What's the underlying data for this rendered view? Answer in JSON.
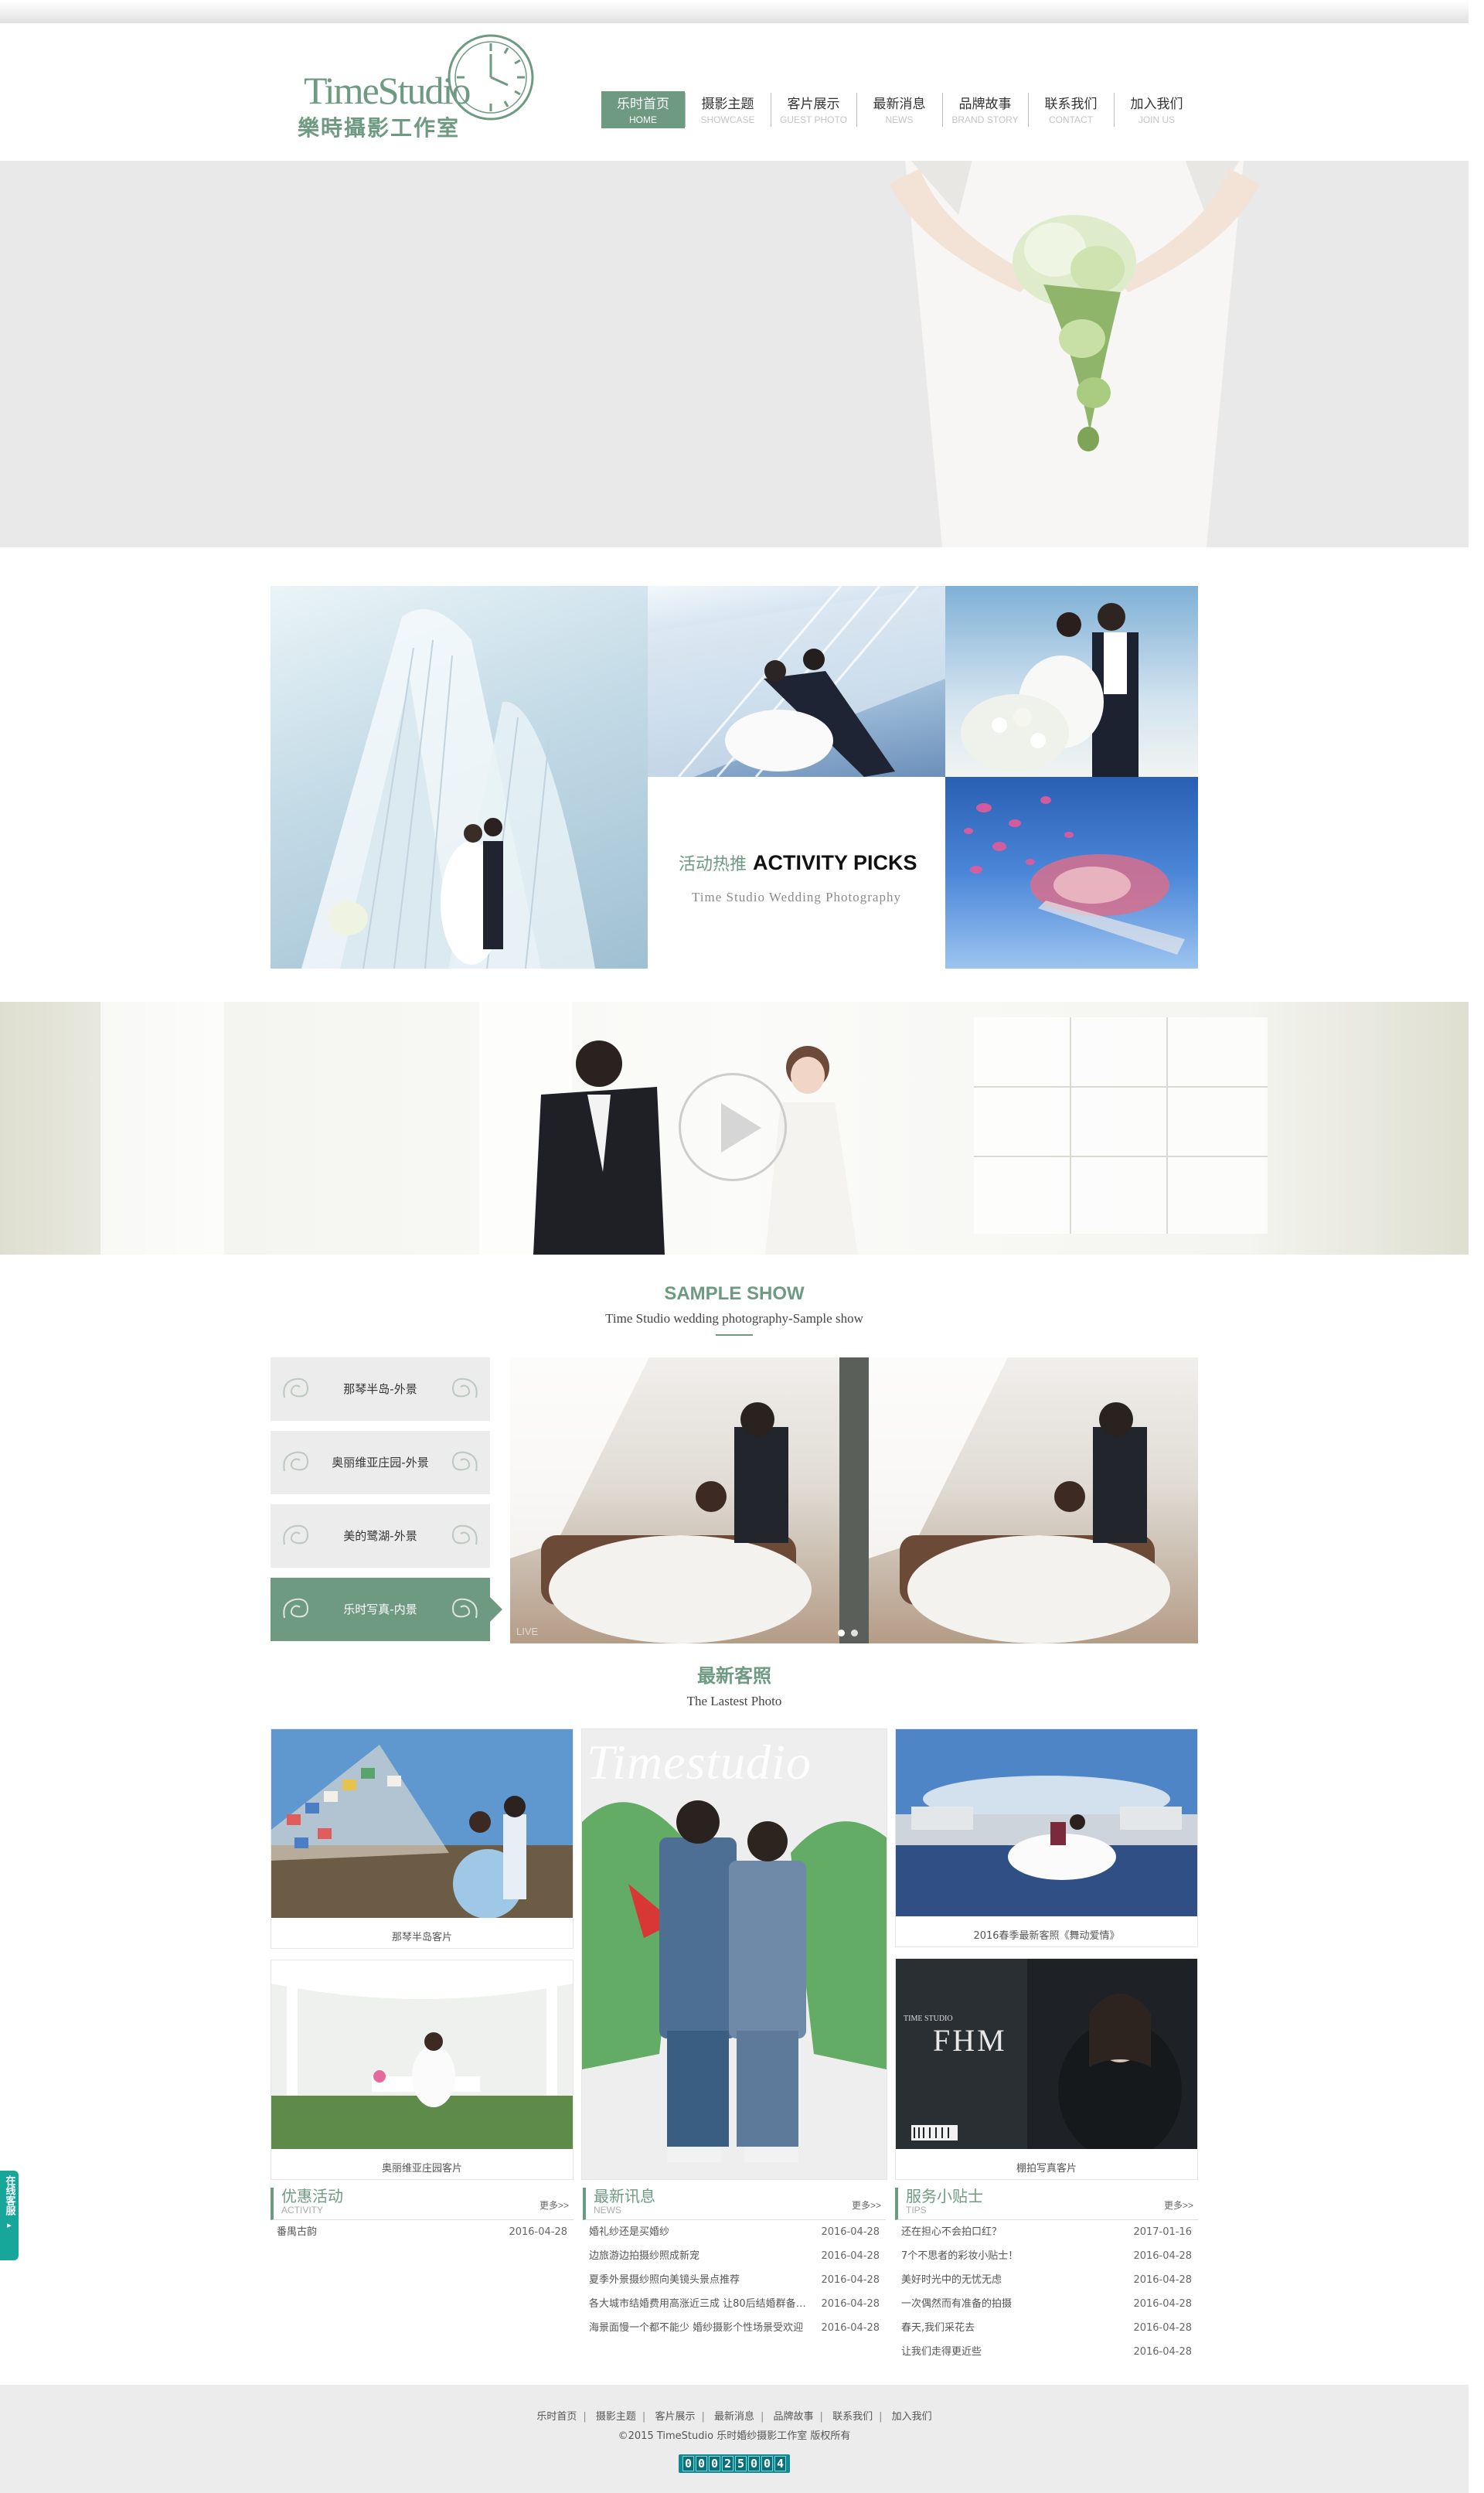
{
  "brand": {
    "logo_en": "TimeStudio",
    "logo_cn": "樂時攝影工作室",
    "accent_color": "#6f9a82"
  },
  "nav": [
    {
      "cn": "乐时首页",
      "en": "HOME",
      "active": true
    },
    {
      "cn": "摄影主题",
      "en": "SHOWCASE"
    },
    {
      "cn": "客片展示",
      "en": "GUEST PHOTO"
    },
    {
      "cn": "最新消息",
      "en": "NEWS"
    },
    {
      "cn": "品牌故事",
      "en": "BRAND STORY"
    },
    {
      "cn": "联系我们",
      "en": "CONTACT"
    },
    {
      "cn": "加入我们",
      "en": "JOIN US"
    }
  ],
  "activity": {
    "title_cn": "活动热推",
    "title_en": "ACTIVITY PICKS",
    "subtitle": "Time Studio Wedding Photography"
  },
  "sample": {
    "title": "SAMPLE SHOW",
    "subtitle": "Time Studio wedding photography-Sample show",
    "items": [
      "那琴半岛-外景",
      "奥丽维亚庄园-外景",
      "美的鹭湖-外景",
      "乐时写真-内景"
    ],
    "active_index": 3,
    "slider_watermark": "LIVE",
    "slider_dots": 2
  },
  "latest": {
    "title": "最新客照",
    "subtitle": "The  Lastest  Photo",
    "banner_text": "Timestudio",
    "cards": [
      {
        "caption": "那琴半岛客片"
      },
      {
        "caption": "奥丽维亚庄园客片"
      },
      {
        "caption": "2016春季最新客照《舞动爱情》"
      },
      {
        "caption": "棚拍写真客片",
        "cover_text": "FHM",
        "cover_small": "TIME STUDIO"
      }
    ]
  },
  "info": [
    {
      "title_cn": "优惠活动",
      "title_en": "ACTIVITY",
      "more": "更多>>",
      "rows": [
        {
          "text": "番禺古韵",
          "date": "2016-04-28"
        }
      ]
    },
    {
      "title_cn": "最新讯息",
      "title_en": "NEWS",
      "more": "更多>>",
      "rows": [
        {
          "text": "婚礼纱还是买婚纱",
          "date": "2016-04-28"
        },
        {
          "text": "边旅游边拍摄纱照成新宠",
          "date": "2016-04-28"
        },
        {
          "text": "夏季外景摄纱照向美镜头景点推荐",
          "date": "2016-04-28"
        },
        {
          "text": "各大城市结婚费用高涨近三成 让80后结婚群备受...",
          "date": "2016-04-28"
        },
        {
          "text": "海景面慢一个都不能少 婚纱摄影个性场景受欢迎",
          "date": "2016-04-28"
        }
      ]
    },
    {
      "title_cn": "服务小贴士",
      "title_en": "TIPS",
      "more": "更多>>",
      "rows": [
        {
          "text": "还在担心不会拍口红？",
          "date": "2017-01-16"
        },
        {
          "text": "7个不思者的彩妆小贴士！",
          "date": "2016-04-28"
        },
        {
          "text": "美好时光中的无忧无虑",
          "date": "2016-04-28"
        },
        {
          "text": "一次偶然而有准备的拍摄",
          "date": "2016-04-28"
        },
        {
          "text": "春天,我们采花去",
          "date": "2016-04-28"
        },
        {
          "text": "让我们走得更近些",
          "date": "2016-04-28"
        }
      ]
    }
  ],
  "footer": {
    "links": [
      "乐时首页",
      "摄影主题",
      "客片展示",
      "最新消息",
      "品牌故事",
      "联系我们",
      "加入我们"
    ],
    "copyright": "©2015 TimeStudio 乐时婚纱摄影工作室 版权所有",
    "counter": "00025004"
  },
  "side_tab": {
    "label": "在线客服",
    "arrow": "▸"
  }
}
